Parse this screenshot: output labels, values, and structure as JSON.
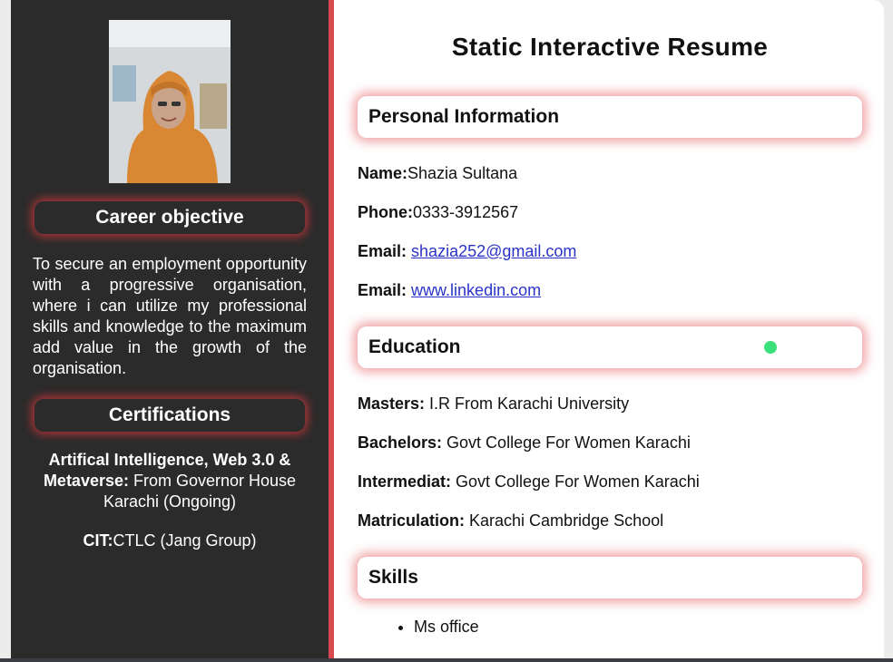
{
  "sidebar": {
    "career_heading": "Career objective",
    "career_text": "To secure an employment opportunity with a progressive organisation, where i can utilize my professional skills and knowledge to the maximum add value in the growth of the organisation.",
    "cert_heading": "Certifications",
    "cert_1_bold": "Artifical Intelligence, Web 3.0 & Metaverse:",
    "cert_1_rest": " From Governor House Karachi (Ongoing)",
    "cert_2_bold": "CIT:",
    "cert_2_rest": "CTLC (Jang Group)"
  },
  "main": {
    "title": "Static Interactive Resume",
    "personal": {
      "heading": "Personal Information",
      "name_label": "Name:",
      "name_value": "Shazia Sultana",
      "phone_label": "Phone:",
      "phone_value": "0333-3912567",
      "email_label": "Email:",
      "email_value": "shazia252@gmail.com",
      "linkedin_label": "Email:",
      "linkedin_value": "www.linkedin.com"
    },
    "education": {
      "heading": "Education",
      "items": [
        {
          "label": "Masters:",
          "value": " I.R From Karachi University"
        },
        {
          "label": "Bachelors:",
          "value": " Govt College For Women Karachi"
        },
        {
          "label": "Intermediat:",
          "value": " Govt College For Women Karachi"
        },
        {
          "label": "Matriculation:",
          "value": " Karachi Cambridge School"
        }
      ]
    },
    "skills": {
      "heading": "Skills",
      "items": [
        "Ms office"
      ]
    }
  },
  "colors": {
    "sidebar_bg": "#2b2b2b",
    "accent_red": "#d84a4f",
    "link_blue": "#2a33c9",
    "status_green": "#3ce07a"
  }
}
